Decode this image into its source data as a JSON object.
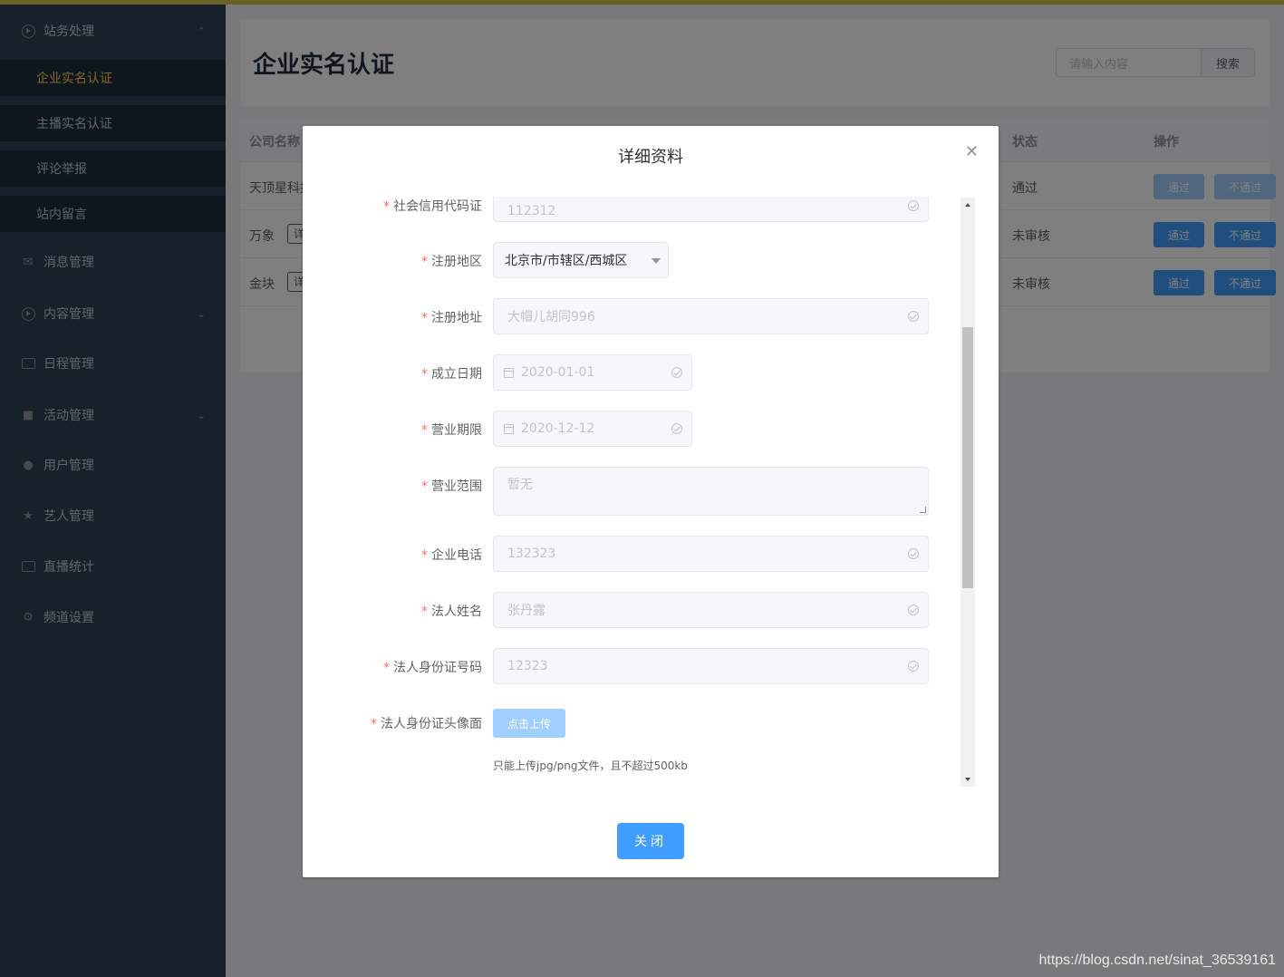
{
  "sidebar": {
    "groups": [
      {
        "label": "站务处理",
        "icon": "play-circle-icon"
      },
      {
        "label": "消息管理",
        "icon": "mail-icon"
      },
      {
        "label": "内容管理",
        "icon": "play-circle-icon"
      },
      {
        "label": "日程管理",
        "icon": "calendar-icon"
      },
      {
        "label": "活动管理",
        "icon": "ticket-icon"
      },
      {
        "label": "用户管理",
        "icon": "user-icon"
      },
      {
        "label": "艺人管理",
        "icon": "star-icon"
      },
      {
        "label": "直播统计",
        "icon": "video-camera-icon"
      },
      {
        "label": "频道设置",
        "icon": "gear-icon"
      }
    ],
    "sub_items": [
      "企业实名认证",
      "主播实名认证",
      "评论举报",
      "站内留言"
    ],
    "active_sub": "企业实名认证",
    "active_color": "#ffd04b"
  },
  "page": {
    "title": "企业实名认证",
    "search_placeholder": "请输入内容",
    "search_button": "搜索"
  },
  "table": {
    "headers": {
      "company": "公司名称",
      "status": "状态",
      "actions": "操作"
    },
    "rows": [
      {
        "company": "天顶星科技",
        "status": "通过",
        "detail": "",
        "pass": "通过",
        "fail": "不通过"
      },
      {
        "company": "万象",
        "status": "未审核",
        "detail": "详",
        "pass": "通过",
        "fail": "不通过"
      },
      {
        "company": "金块",
        "status": "未审核",
        "detail": "详",
        "pass": "通过",
        "fail": "不通过"
      }
    ]
  },
  "dialog": {
    "title": "详细资料",
    "fields": {
      "credit_code": {
        "label": "社会信用代码证",
        "value": "112312"
      },
      "region": {
        "label": "注册地区",
        "value": "北京市/市辖区/西城区"
      },
      "address": {
        "label": "注册地址",
        "value": "大帽儿胡同996"
      },
      "founded": {
        "label": "成立日期",
        "value": "2020-01-01"
      },
      "term": {
        "label": "营业期限",
        "value": "2020-12-12"
      },
      "scope": {
        "label": "营业范围",
        "value": "暂无"
      },
      "phone": {
        "label": "企业电话",
        "value": "132323"
      },
      "legal_name": {
        "label": "法人姓名",
        "value": "张丹露"
      },
      "legal_id": {
        "label": "法人身份证号码",
        "value": "12323"
      },
      "id_photo": {
        "label": "法人身份证头像面",
        "button": "点击上传",
        "tip": "只能上传jpg/png文件，且不超过500kb"
      }
    },
    "required_mark": "*",
    "close_button": "关闭"
  },
  "watermark": "https://blog.csdn.net/sinat_36539161",
  "colors": {
    "primary": "#409eff",
    "sidebar_bg": "#304156",
    "required": "#f56c6c"
  }
}
